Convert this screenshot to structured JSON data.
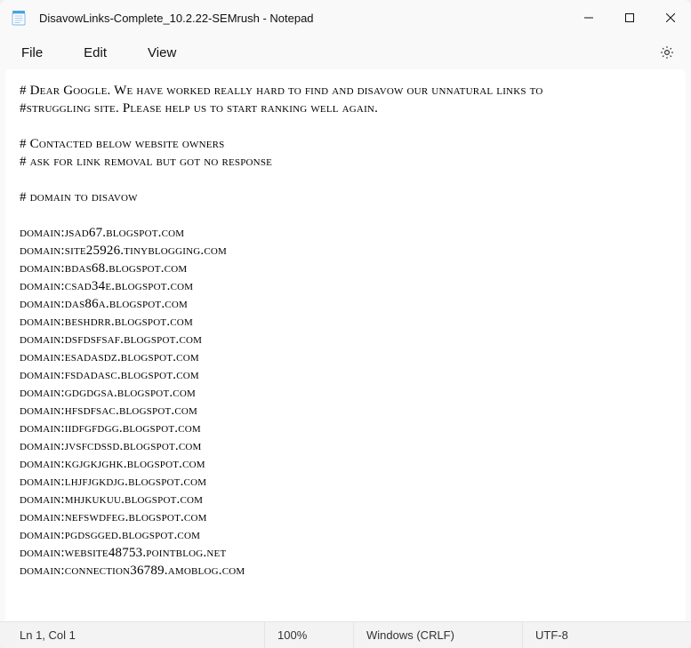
{
  "titlebar": {
    "title": "DisavowLinks-Complete_10.2.22-SEMrush - Notepad"
  },
  "menubar": {
    "file": "File",
    "edit": "Edit",
    "view": "View"
  },
  "content": {
    "lines": [
      "# Dear Google. We have worked really hard to find and disavow our unnatural links to",
      "#struggling site. Please help us to start ranking well again.",
      "",
      "# Contacted below website owners",
      "# ask for link removal but got no response",
      "",
      "# domain to disavow",
      "",
      "domain:jsad67.blogspot.com",
      "domain:site25926.tinyblogging.com",
      "domain:bdas68.blogspot.com",
      "domain:csad34e.blogspot.com",
      "domain:das86a.blogspot.com",
      "domain:beshdrr.blogspot.com",
      "domain:dsfdsfsaf.blogspot.com",
      "domain:esadasdz.blogspot.com",
      "domain:fsdadasc.blogspot.com",
      "domain:gdgdgsa.blogspot.com",
      "domain:hfsdfsac.blogspot.com",
      "domain:iidfgfdgg.blogspot.com",
      "domain:jvsfcdssd.blogspot.com",
      "domain:kgjgkjghk.blogspot.com",
      "domain:lhjfjgkdjg.blogspot.com",
      "domain:mhjkukuu.blogspot.com",
      "domain:nefswdfeg.blogspot.com",
      "domain:pgdsgged.blogspot.com",
      "domain:website48753.pointblog.net",
      "domain:connection36789.amoblog.com"
    ]
  },
  "statusbar": {
    "position": "Ln 1, Col 1",
    "zoom": "100%",
    "lineending": "Windows (CRLF)",
    "encoding": "UTF-8"
  }
}
